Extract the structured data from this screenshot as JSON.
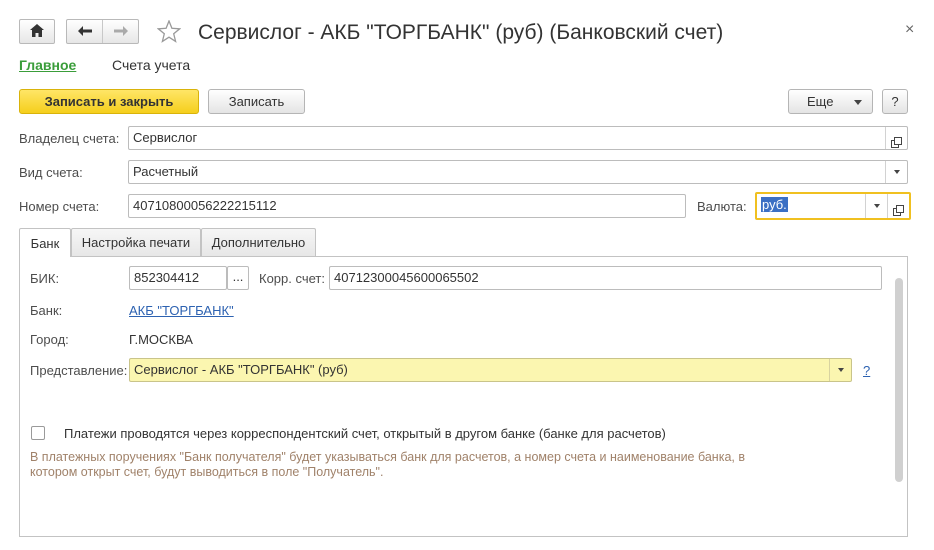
{
  "window": {
    "title": "Сервислог - АКБ \"ТОРГБАНК\" (руб) (Банковский счет)",
    "close_glyph": "×"
  },
  "sections": {
    "main": "Главное",
    "accounts": "Счета учета"
  },
  "commands": {
    "save_close": "Записать и закрыть",
    "save": "Записать",
    "more": "Еще",
    "help": "?"
  },
  "form": {
    "owner_label": "Владелец счета:",
    "owner_value": "Сервислог",
    "type_label": "Вид счета:",
    "type_value": "Расчетный",
    "number_label": "Номер счета:",
    "number_value": "40710800056222215112",
    "currency_label": "Валюта:",
    "currency_value": "руб."
  },
  "tabs": [
    {
      "label": "Банк",
      "active": true
    },
    {
      "label": "Настройка печати",
      "active": false
    },
    {
      "label": "Дополнительно",
      "active": false
    }
  ],
  "bank_tab": {
    "bik_label": "БИК:",
    "bik_value": "852304412",
    "bik_select": "...",
    "corr_label": "Корр. счет:",
    "corr_value": "40712300045600065502",
    "bank_label": "Банк:",
    "bank_value": "АКБ \"ТОРГБАНК\"",
    "city_label": "Город:",
    "city_value": "Г.МОСКВА",
    "repr_label": "Представление:",
    "repr_value": "Сервислог - АКБ \"ТОРГБАНК\" (руб)",
    "repr_help": "?",
    "corr_checkbox_label": "Платежи проводятся через корреспондентский счет, открытый в другом банке (банке для расчетов)",
    "corr_checkbox_checked": false,
    "hint": "В платежных поручениях \"Банк получателя\" будет указываться банк для расчетов, а номер счета и наименование банка, в котором открыт счет, будут выводиться в поле \"Получатель\"."
  },
  "icons": {
    "home": "home-icon",
    "back": "arrow-left-icon",
    "forward": "arrow-right-icon",
    "favorite": "star-icon",
    "open": "open-form-icon",
    "dropdown": "chevron-down-icon"
  },
  "colors": {
    "primary_button": "#f5cf1c",
    "section_active": "#3a9d3a",
    "link": "#2d62b1",
    "highlight_field": "#fbf6b0",
    "focus_border": "#f0c020",
    "hint_text": "#a0826a"
  }
}
